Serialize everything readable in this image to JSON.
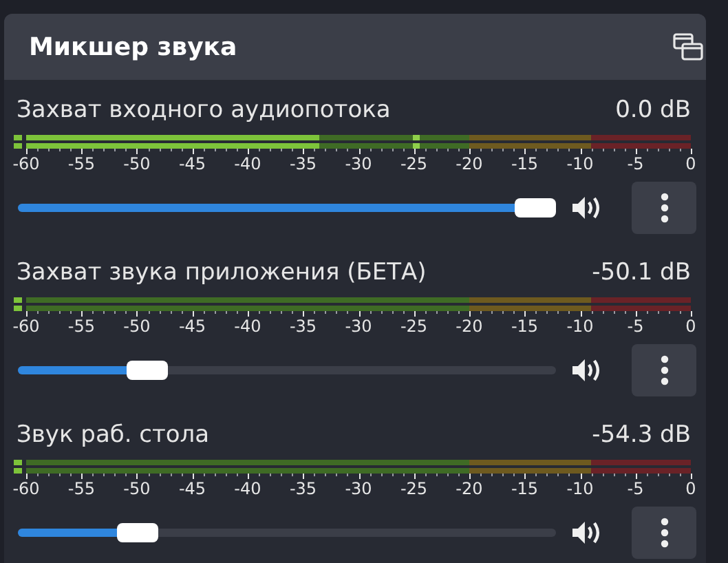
{
  "panel": {
    "title": "Микшер звука"
  },
  "channels": [
    {
      "name": "Захват входного аудиопотока",
      "reading": "0.0 dB",
      "meter": {
        "level": 0.44,
        "peak": {
          "level": 0.585
        }
      },
      "scale": [
        "-60",
        "-55",
        "-50",
        "-45",
        "-40",
        "-35",
        "-30",
        "-25",
        "-20",
        "-15",
        "-10",
        "-5",
        "0"
      ],
      "fader": {
        "level": 1.0
      },
      "muted": false
    },
    {
      "name": "Захват звука приложения (БЕТА)",
      "reading": "-50.1 dB",
      "meter": {
        "level": 0,
        "peak": {
          "level": 0
        }
      },
      "scale": [
        "-60",
        "-55",
        "-50",
        "-45",
        "-40",
        "-35",
        "-30",
        "-25",
        "-20",
        "-15",
        "-10",
        "-5",
        "0"
      ],
      "fader": {
        "level": 0.22
      },
      "muted": false
    },
    {
      "name": "Звук раб. стола",
      "reading": "-54.3 dB",
      "meter": {
        "level": 0,
        "peak": {
          "level": 0
        }
      },
      "scale": [
        "-60",
        "-55",
        "-50",
        "-45",
        "-40",
        "-35",
        "-30",
        "-25",
        "-20",
        "-15",
        "-10",
        "-5",
        "0"
      ],
      "fader": {
        "level": 0.2
      },
      "muted": false
    }
  ]
}
